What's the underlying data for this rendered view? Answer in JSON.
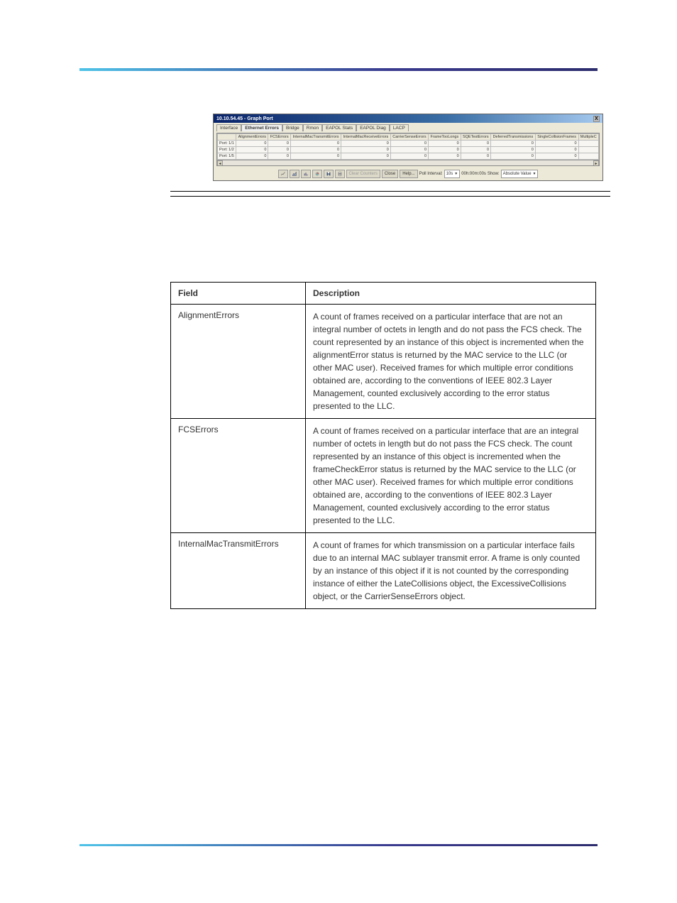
{
  "window": {
    "title": "10.10.54.45 - Graph Port",
    "close_x": "X",
    "tabs": [
      "Interface",
      "Ethernet Errors",
      "Bridge",
      "Rmon",
      "EAPOL Stats",
      "EAPOL Diag",
      "LACP"
    ],
    "active_tab": 1,
    "columns": [
      "",
      "AlignmentErrors",
      "FCSErrors",
      "InternalMacTransmitErrors",
      "InternalMacReceiveErrors",
      "CarrierSenseErrors",
      "FrameTooLongs",
      "SQETestErrors",
      "DeferredTransmissions",
      "SingleCollisionFrames",
      "MultipleC"
    ],
    "rows": [
      {
        "label": "Port: 1/1",
        "vals": [
          "0",
          "0",
          "0",
          "0",
          "0",
          "0",
          "0",
          "0",
          "0"
        ]
      },
      {
        "label": "Port: 1/2",
        "vals": [
          "0",
          "0",
          "0",
          "0",
          "0",
          "0",
          "0",
          "0",
          "0"
        ]
      },
      {
        "label": "Port: 1/5",
        "vals": [
          "0",
          "0",
          "0",
          "0",
          "0",
          "0",
          "0",
          "0",
          "0"
        ]
      }
    ],
    "toolbar": {
      "clear_counters": "Clear Counters",
      "close": "Close",
      "help": "Help...",
      "poll_label": "Poll Interval:",
      "poll_value": "10s",
      "timestamp": "00h:00m:00s",
      "show_label": "Show:",
      "show_value": "Absolute Value"
    }
  },
  "desc": {
    "head_field": "Field",
    "head_desc": "Description",
    "rows": [
      {
        "field": "AlignmentErrors",
        "desc": "A count of frames received on a particular interface that are not an integral number of octets in length and do not pass the FCS check. The count represented by an instance of this object is incremented when the alignmentError status is returned by the MAC service to the LLC (or other MAC user). Received frames for which multiple error conditions obtained are, according to the conventions of IEEE 802.3 Layer Management, counted exclusively according to the error status presented to the LLC."
      },
      {
        "field": "FCSErrors",
        "desc": "A count of frames received on a particular interface that are an integral number of octets in length but do not pass the FCS check. The count represented by an instance of this object is incremented when the frameCheckError status is returned by the MAC service to the LLC (or other MAC user). Received frames for which multiple error conditions obtained are, according to the conventions of IEEE 802.3 Layer Management, counted exclusively according to the error status presented to the LLC."
      },
      {
        "field": "InternalMacTransmitErrors",
        "desc": "A count of frames for which transmission on a particular interface fails due to an internal MAC sublayer transmit error. A frame is only counted by an instance of this object if it is not counted by the corresponding instance of either the LateCollisions object, the ExcessiveCollisions object, or the CarrierSenseErrors object."
      }
    ]
  }
}
